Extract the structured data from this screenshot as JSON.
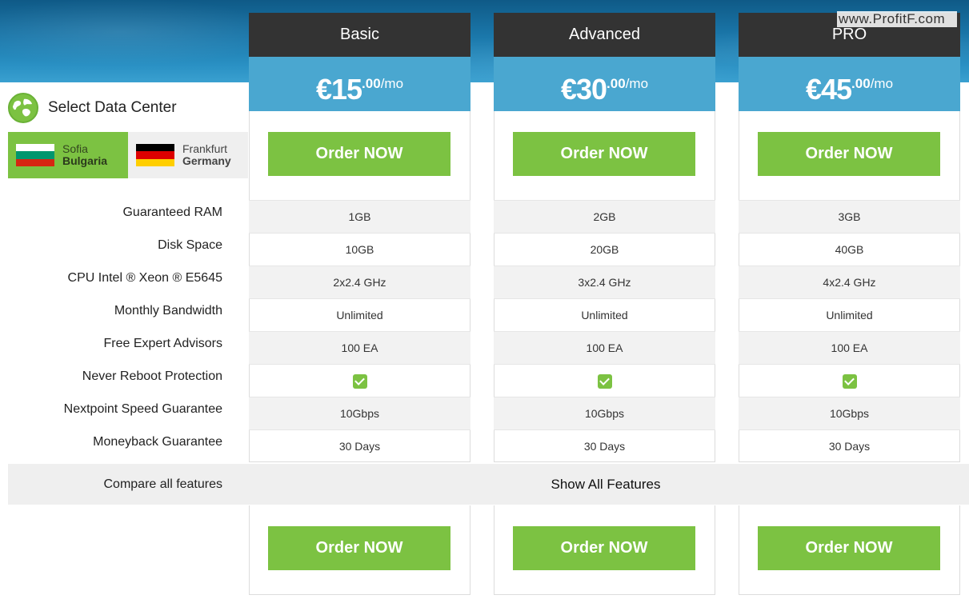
{
  "watermark": "www.ProfitF.com",
  "datacenter": {
    "title": "Select Data Center",
    "options": [
      {
        "city": "Sofia",
        "country": "Bulgaria",
        "active": true,
        "flag_colors": [
          "#ffffff",
          "#00966e",
          "#d62612"
        ]
      },
      {
        "city": "Frankfurt",
        "country": "Germany",
        "active": false,
        "flag_colors": [
          "#000000",
          "#dd0000",
          "#ffce00"
        ]
      }
    ]
  },
  "features": [
    "Guaranteed RAM",
    "Disk Space",
    "CPU Intel ® Xeon ® E5645",
    "Monthly Bandwidth",
    "Free Expert Advisors",
    "Never Reboot Protection",
    "Nextpoint Speed Guarantee",
    "Moneyback Guarantee"
  ],
  "plans": [
    {
      "name": "Basic",
      "price": "€15",
      "cents": ".00",
      "unit": "/mo",
      "order_label": "Order NOW",
      "values": [
        "1GB",
        "10GB",
        "2x2.4 GHz",
        "Unlimited",
        "100 EA",
        "check",
        "10Gbps",
        "30 Days"
      ]
    },
    {
      "name": "Advanced",
      "price": "€30",
      "cents": ".00",
      "unit": "/mo",
      "order_label": "Order NOW",
      "values": [
        "2GB",
        "20GB",
        "3x2.4 GHz",
        "Unlimited",
        "100 EA",
        "check",
        "10Gbps",
        "30 Days"
      ]
    },
    {
      "name": "PRO",
      "price": "€45",
      "cents": ".00",
      "unit": "/mo",
      "order_label": "Order NOW",
      "values": [
        "3GB",
        "40GB",
        "4x2.4 GHz",
        "Unlimited",
        "100 EA",
        "check",
        "10Gbps",
        "30 Days"
      ]
    }
  ],
  "compare": {
    "label": "Compare all features",
    "show_all": "Show All Features"
  },
  "colors": {
    "accent_green": "#7cc242",
    "price_blue": "#4aa7d0",
    "header_dark": "#333333"
  }
}
